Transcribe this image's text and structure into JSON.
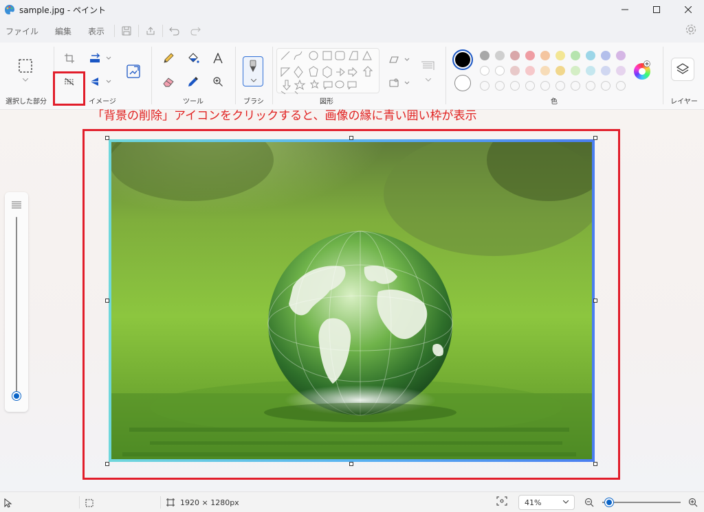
{
  "window": {
    "title": "sample.jpg - ペイント",
    "controls": [
      "minimize",
      "maximize",
      "close"
    ]
  },
  "menu": {
    "items": [
      "ファイル",
      "編集",
      "表示"
    ],
    "icons": [
      "save-icon",
      "share-icon",
      "undo-icon",
      "redo-icon"
    ]
  },
  "ribbon": {
    "groups": {
      "selection": "選択した部分",
      "image": "イメージ",
      "tools": "ツール",
      "brush": "ブラシ",
      "shapes": "図形",
      "color": "色",
      "layers": "レイヤー"
    }
  },
  "colors": {
    "primary": "#000000",
    "secondary": "#ffffff",
    "palette": [
      "#a8a8a8",
      "#cfcfcf",
      "#e0a6a8",
      "#f0a5aa",
      "#f5c9a0",
      "#f4e99a",
      "#b9e6b2",
      "#9fd8e8",
      "#b6c2ec",
      "#d6b8e6"
    ],
    "palette_row2": [
      "#ffffff",
      "#ffffff",
      "#e8c8c8",
      "#f6c6c8",
      "#f7deb9",
      "#f4eeb6",
      "#d6efc8",
      "#c6e8f0",
      "#d2d9f2",
      "#e6d6ef"
    ],
    "annotation": "#e0201f",
    "selection_border": "#4a7ef0"
  },
  "annotation": {
    "text": "「背景の削除」アイコンをクリックすると、画像の縁に青い囲い枠が表示"
  },
  "status": {
    "dimensions": "1920 × 1280px",
    "zoom": "41%",
    "zoom_fraction": 0.05
  }
}
